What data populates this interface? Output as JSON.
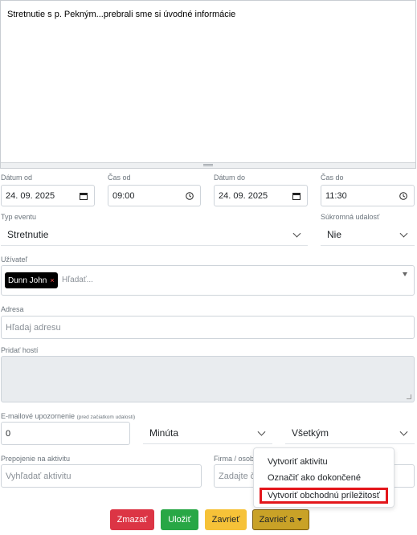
{
  "editor": {
    "content": "Stretnutie s p. Pekným...prebrali sme si úvodné informácie"
  },
  "dates": {
    "date_from_label": "Dátum od",
    "date_from_value": "24. 09. 2025",
    "time_from_label": "Čas od",
    "time_from_value": "09:00",
    "date_to_label": "Dátum do",
    "date_to_value": "24. 09. 2025",
    "time_to_label": "Čas do",
    "time_to_value": "11:30"
  },
  "event": {
    "type_label": "Typ eventu",
    "type_value": "Stretnutie",
    "private_label": "Súkromná udalosť",
    "private_value": "Nie"
  },
  "user": {
    "label": "Užívateľ",
    "tag": "Dunn John",
    "tag_remove": "×",
    "search_placeholder": "Hľadať..."
  },
  "address": {
    "label": "Adresa",
    "placeholder": "Hľadaj adresu"
  },
  "guests": {
    "label": "Pridať hostí"
  },
  "reminder": {
    "label": "E-mailové upozornenie",
    "label_note": "(pred začiatkom udalosti)",
    "value": "0",
    "unit": "Minúta",
    "recipients": "Všetkým"
  },
  "link": {
    "label": "Prepojenie na aktivitu",
    "placeholder": "Vyhľadať aktivitu",
    "company_label": "Firma / osob",
    "company_placeholder": "Zadajte č"
  },
  "dropdown": {
    "items": [
      "Vytvoriť aktivitu",
      "Označiť ako dokončené",
      "Vytvoriť obchodnú príležitosť"
    ]
  },
  "buttons": {
    "delete": "Zmazať",
    "save": "Uložiť",
    "close": "Zavrieť",
    "close_and": "Zavrieť a"
  },
  "colors": {
    "delete": "#dc3545",
    "save": "#28a745",
    "close": "#f6c238",
    "highlight": "#e3161b"
  }
}
